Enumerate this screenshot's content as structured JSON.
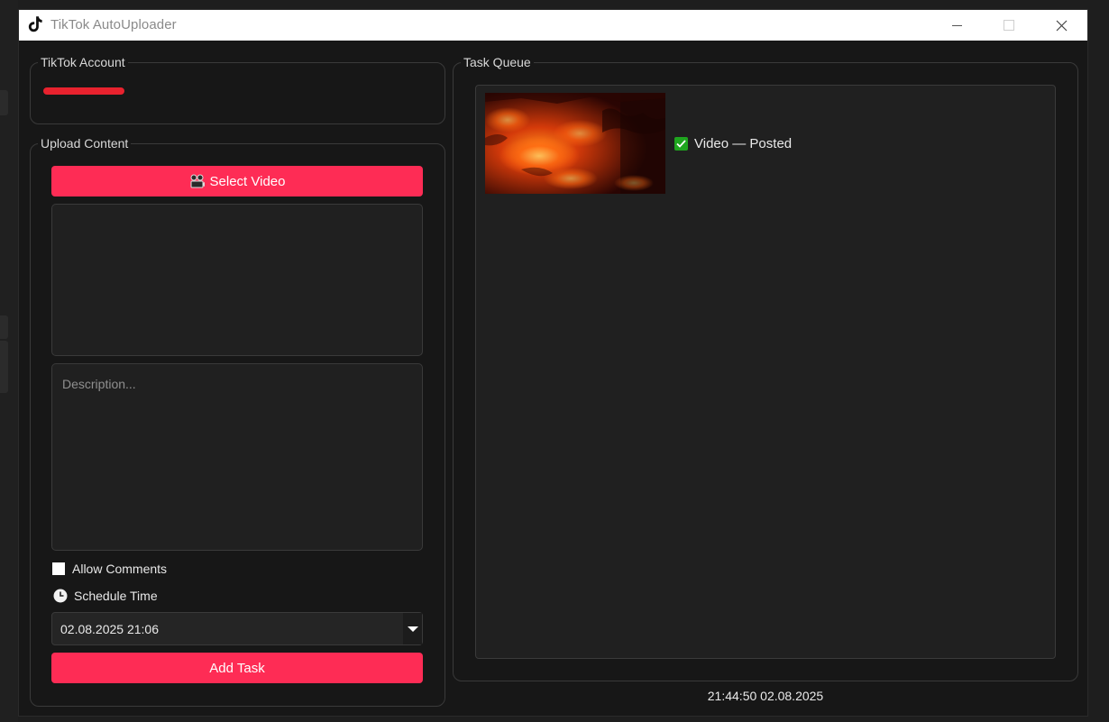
{
  "window": {
    "title": "TikTok AutoUploader",
    "app_icon": "tiktok-logo-icon",
    "controls": [
      "minimize-icon",
      "maximize-icon",
      "close-icon"
    ]
  },
  "account_panel": {
    "title": "TikTok Account"
  },
  "upload_panel": {
    "title": "Upload Content",
    "select_video_icon": "film-projector-icon",
    "select_video_label": "Select Video",
    "description_placeholder": "Description...",
    "allow_comments_label": "Allow Comments",
    "allow_comments_checked": false,
    "schedule_icon": "clock-icon",
    "schedule_label": "Schedule Time",
    "schedule_value": "02.08.2025 21:06",
    "add_task_label": "Add Task"
  },
  "queue_panel": {
    "title": "Task Queue",
    "items": [
      {
        "status_icon": "check-box-icon",
        "status": "Video — Posted"
      }
    ]
  },
  "status_bar": {
    "clock": "21:44:50 02.08.2025"
  },
  "colors": {
    "accent": "#fe2c55",
    "background": "#171717",
    "panel": "#202020",
    "border": "#3a3a3a",
    "success": "#1fa51f"
  }
}
